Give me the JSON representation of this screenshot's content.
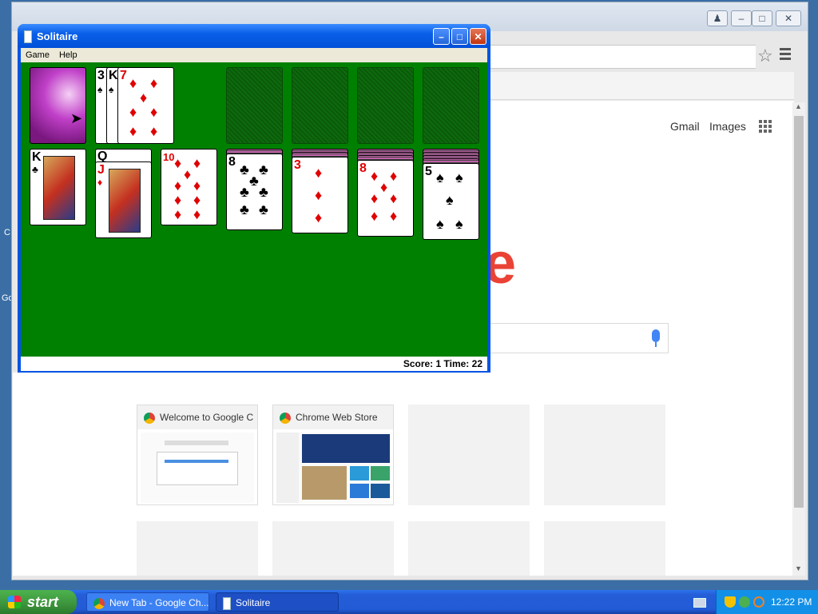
{
  "desktop": {
    "partial_labels": [
      "C",
      "Go"
    ]
  },
  "chrome": {
    "window_controls": [
      "♟",
      "–",
      "□",
      "✕"
    ],
    "toolbar": {
      "star_icon": "☆"
    },
    "ntp": {
      "top_links": [
        "Gmail",
        "Images"
      ],
      "logo_fragment": "e",
      "tiles": [
        {
          "title": "Welcome to Google C",
          "filled": true
        },
        {
          "title": "Chrome Web Store",
          "filled": true
        },
        {
          "title": "",
          "filled": false
        },
        {
          "title": "",
          "filled": false
        },
        {
          "title": "",
          "filled": false
        },
        {
          "title": "",
          "filled": false
        },
        {
          "title": "",
          "filled": false
        },
        {
          "title": "",
          "filled": false
        }
      ]
    }
  },
  "solitaire": {
    "title": "Solitaire",
    "menu": [
      "Game",
      "Help"
    ],
    "buttons": {
      "minimize": "–",
      "maximize": "□",
      "close": "✕"
    },
    "waste": [
      {
        "rank": "3",
        "suit": "♠"
      },
      {
        "rank": "K",
        "suit": "♠"
      },
      {
        "rank": "7",
        "suit": "♦"
      }
    ],
    "tableau": [
      {
        "hidden": 0,
        "cards": [
          {
            "rank": "K",
            "suit": "♣"
          }
        ]
      },
      {
        "hidden": 0,
        "cards": [
          {
            "rank": "Q",
            "suit": "♣"
          },
          {
            "rank": "J",
            "suit": "♦"
          }
        ]
      },
      {
        "hidden": 0,
        "cards": [
          {
            "rank": "10",
            "suit": "♦"
          }
        ]
      },
      {
        "hidden": 1,
        "cards": [
          {
            "rank": "8",
            "suit": "♣"
          }
        ]
      },
      {
        "hidden": 2,
        "cards": [
          {
            "rank": "3",
            "suit": "♦"
          }
        ]
      },
      {
        "hidden": 3,
        "cards": [
          {
            "rank": "8",
            "suit": "♦"
          }
        ]
      },
      {
        "hidden": 4,
        "cards": [
          {
            "rank": "5",
            "suit": "♠"
          }
        ]
      }
    ],
    "status": "Score: 1 Time: 22"
  },
  "taskbar": {
    "start_label": "start",
    "tasks": [
      {
        "label": "New Tab - Google Ch...",
        "active": false
      },
      {
        "label": "Solitaire",
        "active": true
      }
    ],
    "clock": "12:22 PM"
  },
  "colors": {
    "felt": "#008000",
    "xp_blue": "#0054e3",
    "chrome_red": "#ea4335"
  }
}
